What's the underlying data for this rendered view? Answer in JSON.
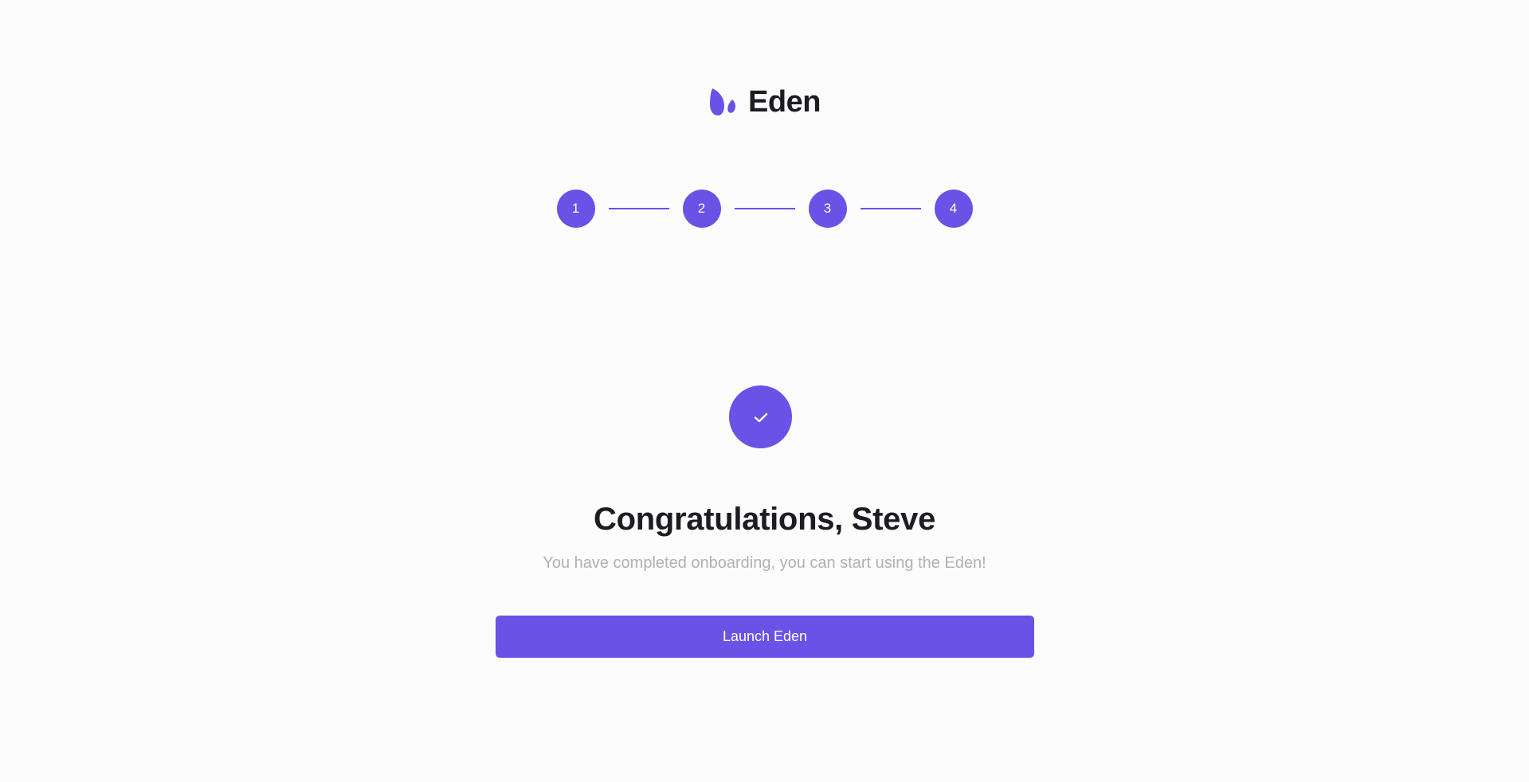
{
  "brand": {
    "name": "Eden",
    "logo_icon": "leaf-logo-icon",
    "accent_color": "#6a52e6"
  },
  "stepper": {
    "steps": [
      "1",
      "2",
      "3",
      "4"
    ],
    "completed_steps": 4,
    "total_steps": 4
  },
  "success": {
    "icon": "check-icon",
    "title": "Congratulations, Steve",
    "subtitle": "You have completed onboarding, you can start using the Eden!"
  },
  "actions": {
    "launch_label": "Launch Eden"
  }
}
